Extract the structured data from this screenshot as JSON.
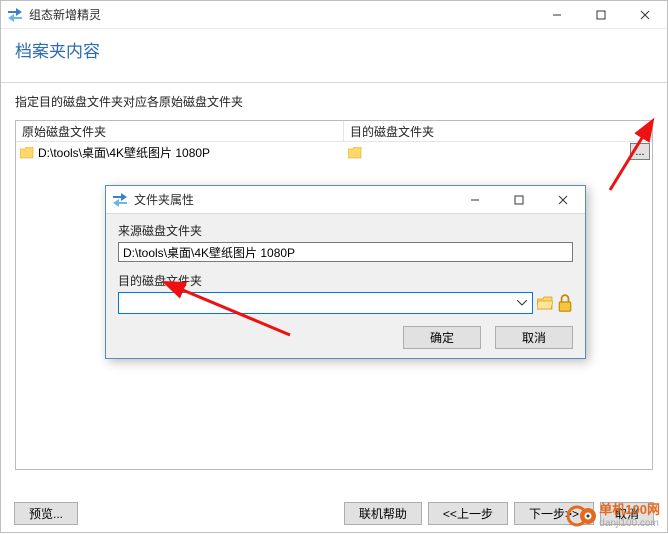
{
  "outer": {
    "title": "组态新增精灵",
    "header": "档案夹内容",
    "instruction": "指定目的磁盘文件夹对应各原始磁盘文件夹",
    "col_src": "原始磁盘文件夹",
    "col_dst": "目的磁盘文件夹",
    "row": {
      "src_path": "D:\\tools\\桌面\\4K壁纸图片 1080P",
      "dst_path": ""
    },
    "ellipsis": "...",
    "preview": "预览...",
    "help": "联机帮助",
    "back": "<<上一步",
    "next": "下一步>>",
    "cancel": "取消"
  },
  "dialog": {
    "title": "文件夹属性",
    "src_label": "来源磁盘文件夹",
    "src_value": "D:\\tools\\桌面\\4K壁纸图片 1080P",
    "dst_label": "目的磁盘文件夹",
    "dst_value": "",
    "ok": "确定",
    "cancel": "取消"
  },
  "watermark": {
    "cn": "单机100网",
    "en": "danji100.com"
  }
}
